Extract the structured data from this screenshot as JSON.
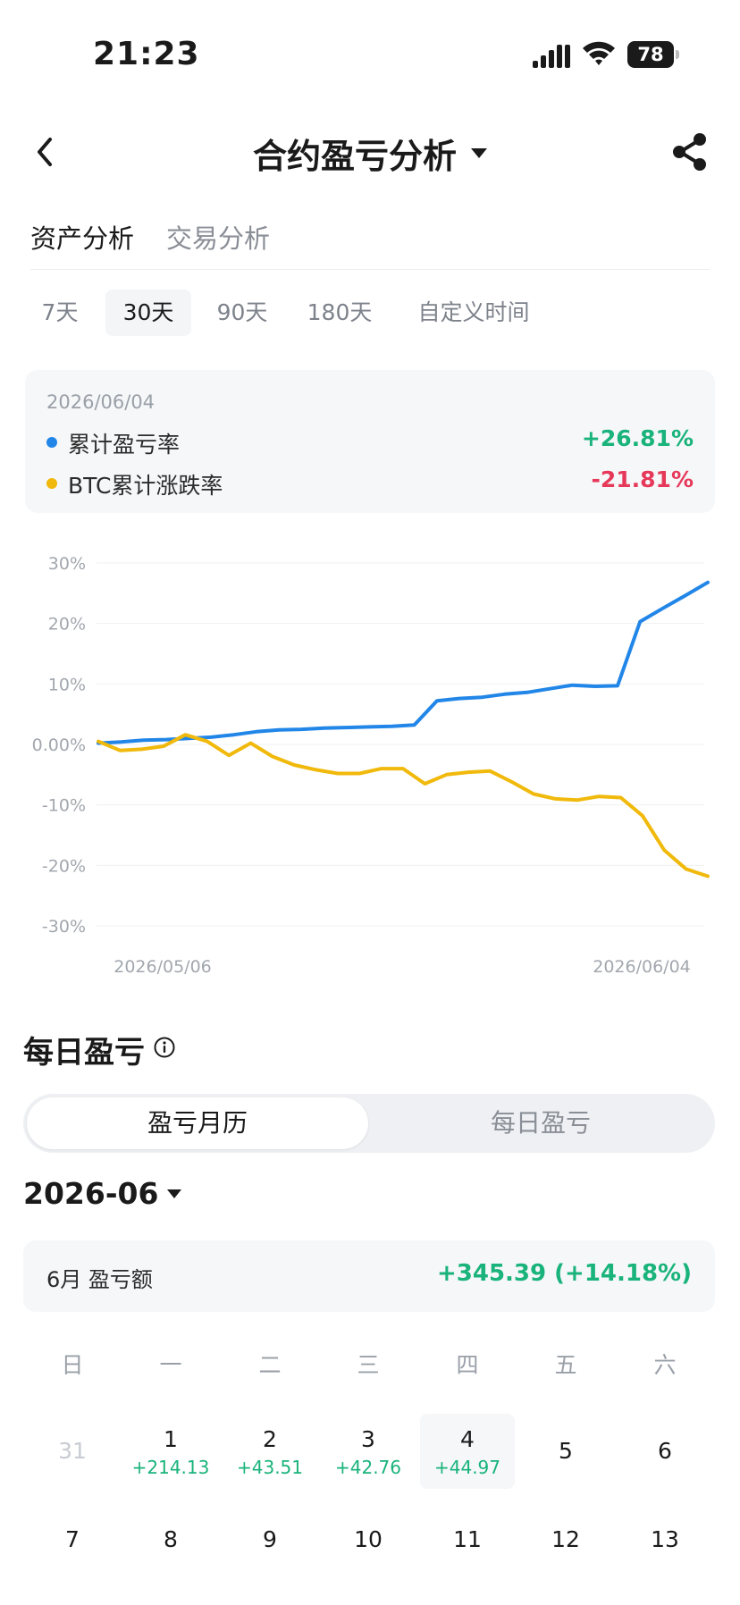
{
  "status": {
    "time": "21:23",
    "battery": "78"
  },
  "header": {
    "title": "合约盈亏分析"
  },
  "main_tabs": [
    {
      "label": "资产分析"
    },
    {
      "label": "交易分析"
    }
  ],
  "periods": [
    {
      "label": "7天"
    },
    {
      "label": "30天"
    },
    {
      "label": "90天"
    },
    {
      "label": "180天"
    },
    {
      "label": "自定义时间"
    }
  ],
  "summary": {
    "date": "2026/06/04",
    "items": [
      {
        "label": "累计盈亏率",
        "value": "+26.81%",
        "dot_color": "#2186e8",
        "value_color": "#19b37b"
      },
      {
        "label": "BTC累计涨跌率",
        "value": "-21.81%",
        "dot_color": "#f0b90b",
        "value_color": "#e6395a"
      }
    ]
  },
  "chart_data": {
    "type": "line",
    "x_start_label": "2026/05/06",
    "x_end_label": "2026/06/04",
    "y_ticks": [
      "30%",
      "20%",
      "10%",
      "0.00%",
      "-10%",
      "-20%",
      "-30%"
    ],
    "ylim": [
      -30,
      30
    ],
    "grid": true,
    "series": [
      {
        "name": "累计盈亏率",
        "color": "#2186e8",
        "values": [
          0.2,
          0.4,
          0.7,
          0.8,
          1.0,
          1.2,
          1.6,
          2.1,
          2.4,
          2.5,
          2.7,
          2.8,
          2.9,
          3.0,
          3.2,
          7.2,
          7.6,
          7.8,
          8.3,
          8.6,
          9.2,
          9.8,
          9.6,
          9.7,
          20.3,
          22.5,
          24.6,
          26.8
        ]
      },
      {
        "name": "BTC累计涨跌率",
        "color": "#f0b90b",
        "values": [
          0.5,
          -1.0,
          -0.8,
          -0.3,
          1.6,
          0.5,
          -1.8,
          0.2,
          -2.0,
          -3.4,
          -4.2,
          -4.8,
          -4.8,
          -4.0,
          -4.0,
          -6.5,
          -5.0,
          -4.6,
          -4.4,
          -6.2,
          -8.2,
          -9.0,
          -9.2,
          -8.6,
          -8.8,
          -11.8,
          -17.5,
          -20.6,
          -21.8
        ]
      }
    ]
  },
  "daily": {
    "title": "每日盈亏",
    "seg_calendar": "盈亏月历",
    "seg_daily": "每日盈亏",
    "month": "2026-06",
    "month_label": "6月 盈亏额",
    "month_value": "+345.39 (+14.18%)"
  },
  "calendar": {
    "weekdays": [
      "日",
      "一",
      "二",
      "三",
      "四",
      "五",
      "六"
    ],
    "row1": [
      {
        "day": "31",
        "pnl": ""
      },
      {
        "day": "1",
        "pnl": "+214.13"
      },
      {
        "day": "2",
        "pnl": "+43.51"
      },
      {
        "day": "3",
        "pnl": "+42.76"
      },
      {
        "day": "4",
        "pnl": "+44.97"
      },
      {
        "day": "5",
        "pnl": ""
      },
      {
        "day": "6",
        "pnl": ""
      }
    ],
    "row2": [
      {
        "day": "7"
      },
      {
        "day": "8"
      },
      {
        "day": "9"
      },
      {
        "day": "10"
      },
      {
        "day": "11"
      },
      {
        "day": "12"
      },
      {
        "day": "13"
      }
    ]
  },
  "accents": {
    "green": "#19b37b",
    "red": "#e6395a",
    "blue": "#2186e8",
    "yellow": "#f0b90b"
  },
  "icons": [
    "signal-icon",
    "wifi-icon",
    "battery-icon",
    "back-icon",
    "chevron-down-icon",
    "share-icon",
    "info-icon"
  ]
}
